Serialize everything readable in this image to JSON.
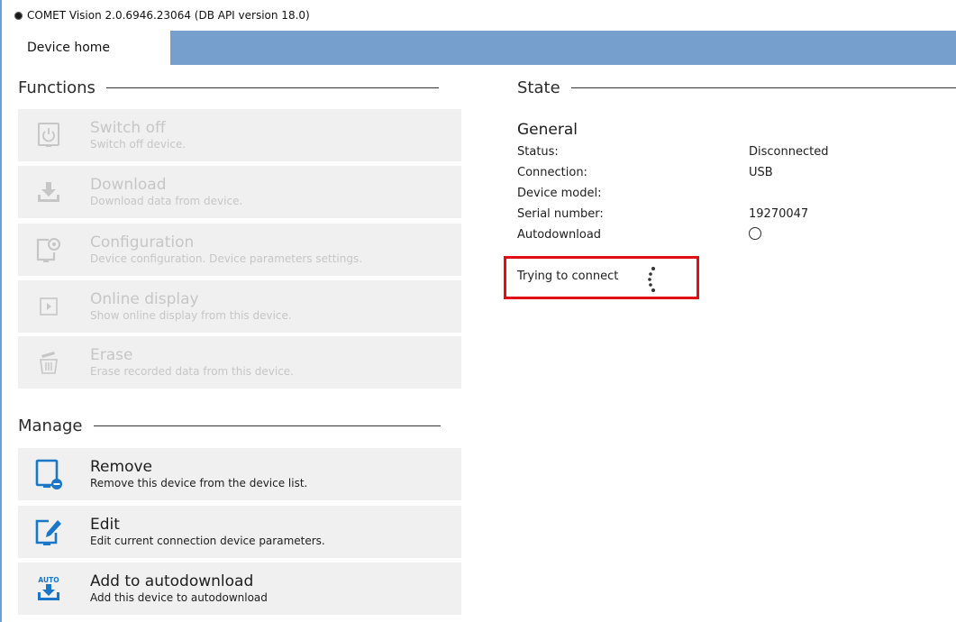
{
  "window": {
    "title": "COMET Vision 2.0.6946.23064 (DB API version 18.0)"
  },
  "tabs": [
    {
      "label": "Device home",
      "active": true
    }
  ],
  "functions": {
    "heading": "Functions",
    "items": [
      {
        "title": "Switch off",
        "description": "Switch off device.",
        "icon": "power-icon",
        "enabled": false
      },
      {
        "title": "Download",
        "description": "Download data from device.",
        "icon": "download-icon",
        "enabled": false
      },
      {
        "title": "Configuration",
        "description": "Device configuration. Device parameters settings.",
        "icon": "device-settings-icon",
        "enabled": false
      },
      {
        "title": "Online display",
        "description": "Show online display from this device.",
        "icon": "play-icon",
        "enabled": false
      },
      {
        "title": "Erase",
        "description": "Erase recorded data from this device.",
        "icon": "trash-icon",
        "enabled": false
      }
    ]
  },
  "manage": {
    "heading": "Manage",
    "items": [
      {
        "title": "Remove",
        "description": "Remove this device from the device list.",
        "icon": "device-remove-icon",
        "enabled": true
      },
      {
        "title": "Edit",
        "description": "Edit current connection device parameters.",
        "icon": "device-edit-icon",
        "enabled": true
      },
      {
        "title": "Add to autodownload",
        "description": "Add this device to autodownload",
        "icon": "auto-download-icon",
        "icon_text": "AUTO",
        "enabled": true
      }
    ]
  },
  "state": {
    "heading": "State",
    "general_title": "General",
    "rows": [
      {
        "label": "Status:",
        "value": "Disconnected"
      },
      {
        "label": "Connection:",
        "value": "USB"
      },
      {
        "label": "Device model:",
        "value": ""
      },
      {
        "label": "Serial number:",
        "value": "19270047"
      },
      {
        "label": "Autodownload",
        "value": ""
      }
    ],
    "connecting_text": "Trying to connect"
  },
  "colors": {
    "accent": "#769fcd",
    "icon_blue": "#1976c8",
    "disabled": "#c6c6c6",
    "highlight": "#e10f14",
    "item_bg": "#f0f0f0"
  }
}
